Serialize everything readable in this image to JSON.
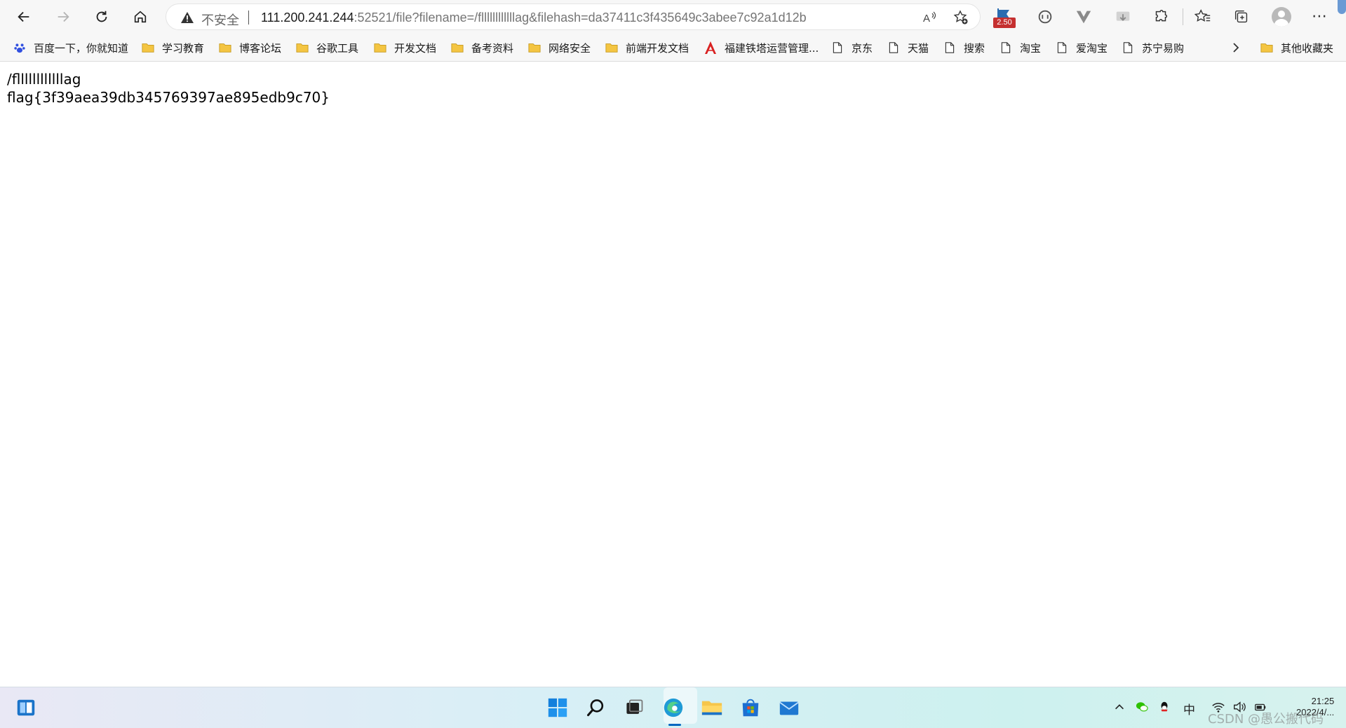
{
  "toolbar": {
    "security_label": "不安全",
    "url_host": "111.200.241.244",
    "url_rest": ":52521/file?filename=/fllllllllllllag&filehash=da37411c3f435649c3abee7c92a1d12b",
    "badge": "2.50"
  },
  "favorites": [
    {
      "label": "百度一下，你就知道",
      "icon": "paw-icon"
    },
    {
      "label": "学习教育",
      "icon": "folder-icon"
    },
    {
      "label": "博客论坛",
      "icon": "folder-icon"
    },
    {
      "label": "谷歌工具",
      "icon": "folder-icon"
    },
    {
      "label": "开发文档",
      "icon": "folder-icon"
    },
    {
      "label": "备考资料",
      "icon": "folder-icon"
    },
    {
      "label": "网络安全",
      "icon": "folder-icon"
    },
    {
      "label": "前端开发文档",
      "icon": "folder-icon"
    },
    {
      "label": "福建铁塔运营管理...",
      "icon": "tower-icon"
    },
    {
      "label": "京东",
      "icon": "page-icon"
    },
    {
      "label": "天猫",
      "icon": "page-icon"
    },
    {
      "label": "搜索",
      "icon": "page-icon"
    },
    {
      "label": "淘宝",
      "icon": "page-icon"
    },
    {
      "label": "爱淘宝",
      "icon": "page-icon"
    },
    {
      "label": "苏宁易购",
      "icon": "page-icon"
    }
  ],
  "other_favorites": "其他收藏夹",
  "content": {
    "line1": "/fllllllllllllag",
    "line2": "flag{3f39aea39db345769397ae895edb9c70}"
  },
  "taskbar": {
    "ime": "中",
    "time": "21:25",
    "date": "2022/4/..."
  },
  "watermark": "CSDN @愚公搬代码",
  "colors": {
    "accent": "#0067c0",
    "badge": "#c53030",
    "folder": "#f4c542"
  }
}
